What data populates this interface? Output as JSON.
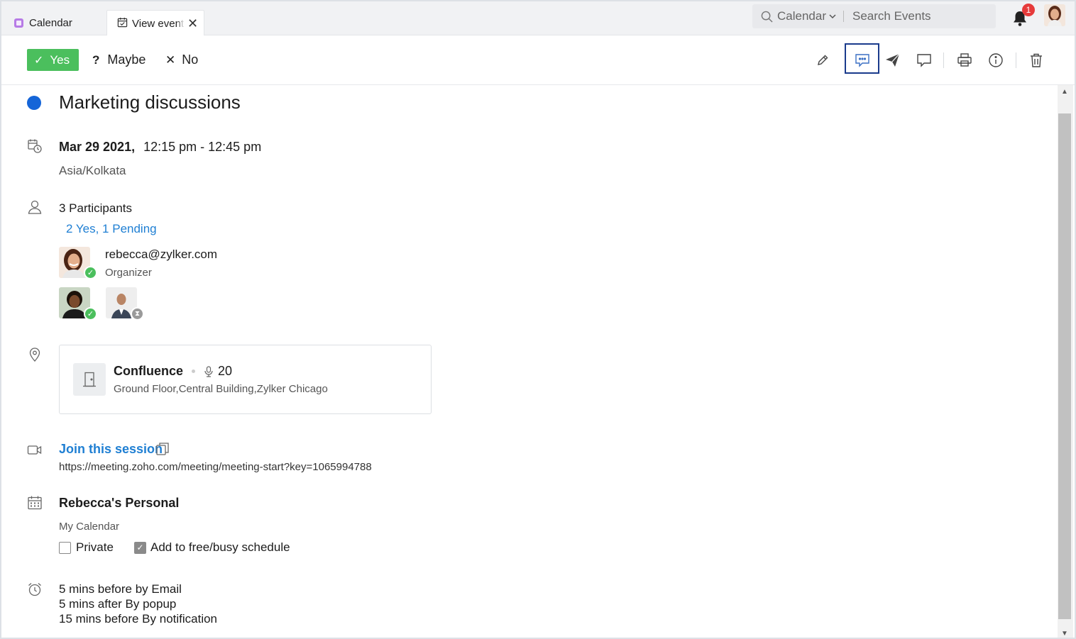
{
  "tabs": [
    {
      "label": "Calendar"
    },
    {
      "label": "View event"
    }
  ],
  "search": {
    "scope": "Calendar",
    "placeholder": "Search Events"
  },
  "notifications": {
    "count": "1"
  },
  "rsvp": {
    "yes": "Yes",
    "maybe": "Maybe",
    "no": "No",
    "yes_glyph": "✓",
    "maybe_glyph": "?",
    "no_glyph": "✕"
  },
  "toolbar_icons": [
    "pencil-icon",
    "chat-icon",
    "send-icon",
    "comment-icon",
    "print-icon",
    "info-icon",
    "trash-icon"
  ],
  "event": {
    "title": "Marketing discussions",
    "color": "#1565d8",
    "date": "Mar 29 2021,",
    "time": "12:15 pm - 12:45 pm",
    "timezone": "Asia/Kolkata"
  },
  "participants": {
    "count_label": "3 Participants",
    "summary": "2 Yes, 1 Pending",
    "organizer_email": "rebecca@zylker.com",
    "organizer_role": "Organizer"
  },
  "location": {
    "room": "Confluence",
    "capacity": "20",
    "address": "Ground Floor,Central Building,Zylker Chicago"
  },
  "meeting": {
    "join_label": "Join this session",
    "url": "https://meeting.zoho.com/meeting/meeting-start?key=1065994788"
  },
  "calendar": {
    "name": "Rebecca's Personal",
    "group": "My Calendar",
    "private_label": "Private",
    "freebusy_label": "Add to free/busy schedule"
  },
  "reminders": [
    "5 mins before by Email",
    "5 mins after By popup",
    "15 mins before By notification"
  ],
  "colors": {
    "yes_green": "#4bbf5d",
    "link_blue": "#1f7fd3",
    "selected_border": "#1a3b8c"
  }
}
